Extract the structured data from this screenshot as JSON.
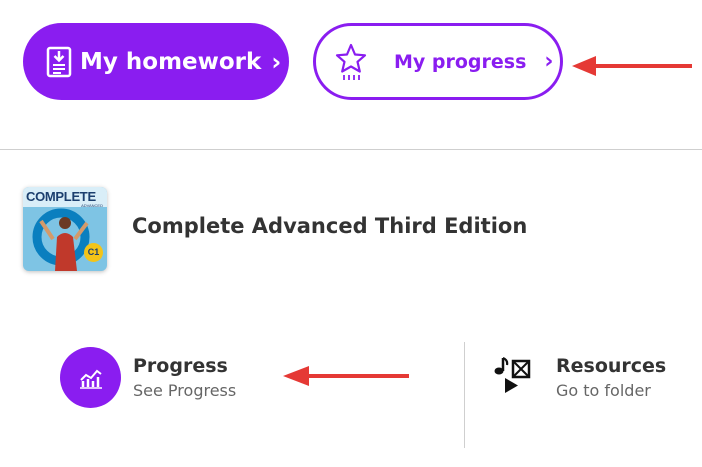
{
  "buttons": {
    "homework": {
      "label": "My homework",
      "icon": "document-download-icon",
      "chevron": "›"
    },
    "progress": {
      "label": "My progress",
      "icon": "star-icon",
      "chevron": "›"
    }
  },
  "book": {
    "title": "Complete Advanced Third Edition",
    "cover": {
      "title": "COMPLETE",
      "subtitle": "ADVANCED",
      "level": "C1"
    }
  },
  "cards": {
    "progress": {
      "title": "Progress",
      "subtitle": "See Progress",
      "icon": "bar-chart-icon"
    },
    "resources": {
      "title": "Resources",
      "subtitle": "Go to folder",
      "icon": "media-resources-icon"
    }
  },
  "colors": {
    "accent": "#8a1df0",
    "annotation_arrow": "#e53935",
    "text": "#333333",
    "muted": "#666666",
    "divider": "#cfcfcf"
  }
}
